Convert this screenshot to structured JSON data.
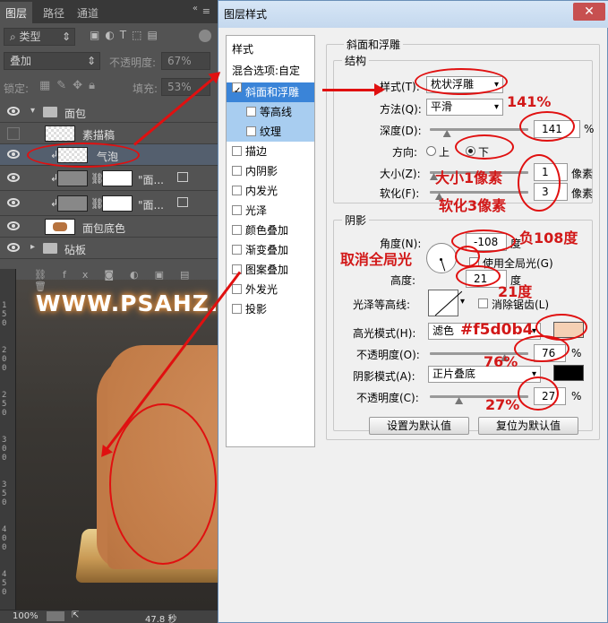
{
  "layers_panel": {
    "tabs": [
      "图层",
      "路径",
      "通道"
    ],
    "filter_label": "类型",
    "blend_mode": "叠加",
    "opacity_label": "不透明度:",
    "opacity_value": "67%",
    "lock_label": "锁定:",
    "fill_label": "填充:",
    "fill_value": "53%",
    "layers": [
      {
        "name": "面包",
        "type": "group"
      },
      {
        "name": "素描稿"
      },
      {
        "name": "气泡"
      },
      {
        "name": "\"面..."
      },
      {
        "name": "\"面..."
      },
      {
        "name": "面包底色"
      },
      {
        "name": "砧板",
        "type": "group"
      }
    ]
  },
  "canvas": {
    "watermark": "WWW.PSAHZ.COM",
    "ruler_ticks": [
      "1",
      "5",
      "0",
      "2",
      "0",
      "0",
      "2",
      "5",
      "0",
      "3",
      "0",
      "0",
      "3",
      "5",
      "0",
      "4",
      "0",
      "0",
      "4",
      "5",
      "0"
    ]
  },
  "status": {
    "zoom": "100%",
    "time": "47.8 秒"
  },
  "dialog": {
    "title": "图层样式",
    "close_icon": "close-icon",
    "styles_header": "样式",
    "blend_options": "混合选项:自定",
    "style_items": [
      {
        "label": "斜面和浮雕",
        "checked": true,
        "highlighted": true
      },
      {
        "label": "等高线",
        "checked": false,
        "sub": true
      },
      {
        "label": "纹理",
        "checked": false,
        "sub": true
      },
      {
        "label": "描边",
        "checked": false
      },
      {
        "label": "内阴影",
        "checked": false
      },
      {
        "label": "内发光",
        "checked": false
      },
      {
        "label": "光泽",
        "checked": false
      },
      {
        "label": "颜色叠加",
        "checked": false
      },
      {
        "label": "渐变叠加",
        "checked": false
      },
      {
        "label": "图案叠加",
        "checked": false
      },
      {
        "label": "外发光",
        "checked": false
      },
      {
        "label": "投影",
        "checked": false
      }
    ],
    "bevel_title": "斜面和浮雕",
    "structure_title": "结构",
    "style_label": "样式(T):",
    "style_value": "枕状浮雕",
    "method_label": "方法(Q):",
    "method_value": "平滑",
    "depth_label": "深度(D):",
    "depth_value": "141",
    "depth_unit": "%",
    "depth_slider": 0.141,
    "direction_label": "方向:",
    "dir_up": "上",
    "dir_down": "下",
    "size_label": "大小(Z):",
    "size_value": "1",
    "soften_label": "软化(F):",
    "soften_value": "3",
    "px_unit": "像素",
    "shading_title": "阴影",
    "angle_label": "角度(N):",
    "angle_value": "-108",
    "degree_unit": "度",
    "global_light_label": "使用全局光(G)",
    "altitude_label": "高度:",
    "altitude_value": "21",
    "gloss_label": "光泽等高线:",
    "antialias_label": "消除锯齿(L)",
    "highlight_mode_label": "高光模式(H):",
    "highlight_mode_value": "滤色",
    "highlight_color": "#f5d0b4",
    "opacity_label": "不透明度(O):",
    "highlight_opacity": "76",
    "highlight_opacity_fraction": 0.76,
    "shadow_mode_label": "阴影模式(A):",
    "shadow_mode_value": "正片叠底",
    "shadow_color": "#000000",
    "shadow_opacity_label": "不透明度(C):",
    "shadow_opacity": "27",
    "shadow_opacity_fraction": 0.27,
    "percent_unit": "%",
    "btn_default": "设置为默认值",
    "btn_reset": "复位为默认值"
  },
  "annotations": {
    "depth": "141%",
    "size": "大小1像素",
    "soften": "软化3像素",
    "angle": "负108度",
    "global": "取消全局光",
    "altitude": "21度",
    "color": "#f5d0b4",
    "hl_opacity": "76%",
    "sh_opacity": "27%"
  }
}
